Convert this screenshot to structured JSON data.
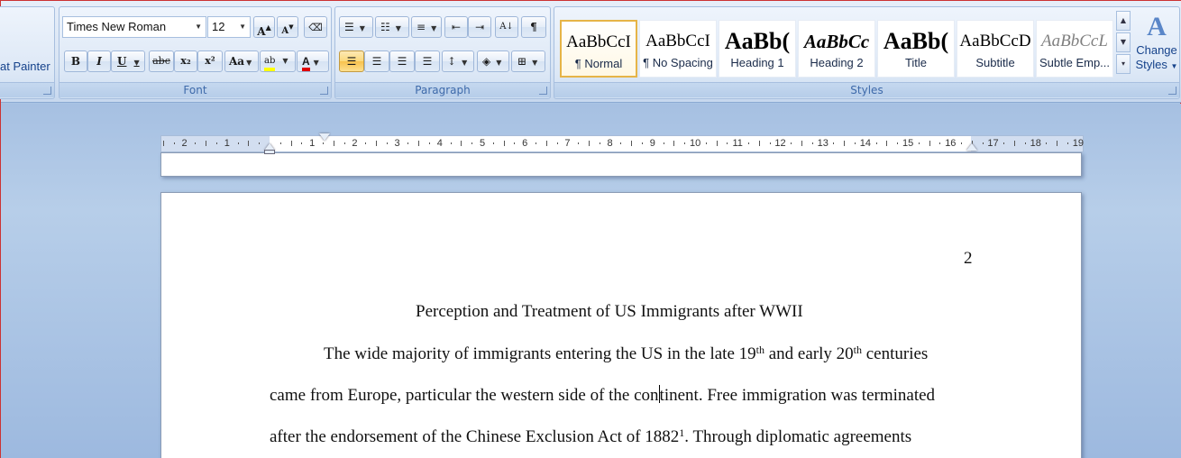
{
  "ribbon": {
    "clipboard": {
      "format_painter_label": "at Painter"
    },
    "font": {
      "label": "Font",
      "font_name": "Times New Roman",
      "font_size": "12",
      "grow_label": "A",
      "shrink_label": "A",
      "clear_label": "A",
      "bold": "B",
      "italic": "I",
      "underline": "U",
      "strike": "abc",
      "subscript": "x₂",
      "superscript": "x²",
      "change_case": "Aa",
      "highlight": "ab",
      "font_color": "A"
    },
    "paragraph": {
      "label": "Paragraph",
      "pilcrow": "¶"
    },
    "styles": {
      "label": "Styles",
      "change_styles_line1": "Change",
      "change_styles_line2": "Styles",
      "items": [
        {
          "sample": "AaBbCcI",
          "name": "¶ Normal"
        },
        {
          "sample": "AaBbCcI",
          "name": "¶ No Spacing"
        },
        {
          "sample": "AaBb(",
          "name": "Heading 1"
        },
        {
          "sample": "AaBbCc",
          "name": "Heading 2"
        },
        {
          "sample": "AaBb(",
          "name": "Title"
        },
        {
          "sample": "AaBbCcD",
          "name": "Subtitle"
        },
        {
          "sample": "AaBbCcL",
          "name": "Subtle Emp..."
        }
      ]
    }
  },
  "ruler": {
    "ticks": [
      "2",
      "1",
      "1",
      "2",
      "3",
      "4",
      "5",
      "6",
      "7",
      "8",
      "9",
      "10",
      "11",
      "12",
      "13",
      "14",
      "15",
      "16",
      "17",
      "18",
      "19"
    ]
  },
  "document": {
    "page_number": "2",
    "title": "Perception and Treatment of US Immigrants after WWII",
    "line1_a": "The wide majority of immigrants entering the US  in the late 19",
    "line1_sup1": "th",
    "line1_b": " and early 20",
    "line1_sup2": "th",
    "line1_c": " centuries",
    "line2_a": "came from Europe, particular the western side of the con",
    "line2_b": "tinent. Free immigration was terminated",
    "line3_a": "after the endorsement of the Chinese Exclusion Act of 1882",
    "line3_sup": "1",
    "line3_b": ". Through diplomatic agreements"
  },
  "colors": {
    "accent": "#15428b",
    "highlight": "#ffff00",
    "font_color_bar": "#e00000",
    "selected_style_border": "#e6b447"
  }
}
